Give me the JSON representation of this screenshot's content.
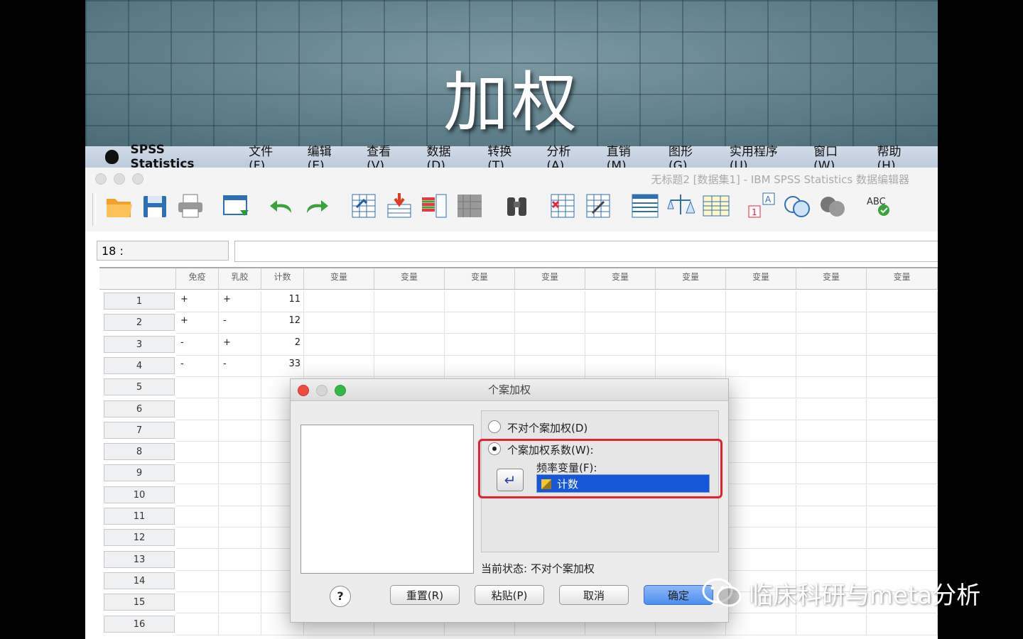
{
  "slide": {
    "title": "加权"
  },
  "menubar": {
    "app": "SPSS Statistics",
    "items": [
      "文件(F)",
      "编辑(E)",
      "查看(V)",
      "数据(D)",
      "转换(T)",
      "分析(A)",
      "直销(M)",
      "图形(G)",
      "实用程序(U)",
      "窗口(W)",
      "帮助(H)"
    ]
  },
  "window": {
    "title": "无标题2 [数据集1] - IBM SPSS Statistics 数据编辑器"
  },
  "toolbar": {
    "icons": [
      "open-folder-icon",
      "save-icon",
      "print-icon",
      "recall-dialog-icon",
      "undo-icon",
      "redo-icon",
      "goto-case-icon",
      "goto-variable-icon",
      "variables-icon",
      "run-descriptive-icon",
      "find-icon",
      "insert-cases-icon",
      "insert-variable-icon",
      "split-file-icon",
      "weight-cases-icon",
      "select-cases-icon",
      "value-labels-icon",
      "use-sets-icon",
      "show-all-variables-icon",
      "spell-check-icon"
    ]
  },
  "cell_editor": {
    "ref": "18 :",
    "value": ""
  },
  "grid": {
    "columns": [
      "免疫",
      "乳胶",
      "计数",
      "变量",
      "变量",
      "变量",
      "变量",
      "变量",
      "变量",
      "变量",
      "变量",
      "变量"
    ],
    "row_numbers": [
      "1",
      "2",
      "3",
      "4",
      "5",
      "6",
      "7",
      "8",
      "9",
      "10",
      "11",
      "12",
      "13",
      "14",
      "15",
      "16"
    ],
    "rows": [
      [
        "+",
        "+",
        "11"
      ],
      [
        "+",
        "-",
        "12"
      ],
      [
        "-",
        "+",
        "2"
      ],
      [
        "-",
        "-",
        "33"
      ]
    ]
  },
  "dialog": {
    "title": "个案加权",
    "radio_none": "不对个案加权(D)",
    "radio_weight": "个案加权系数(W):",
    "freq_label": "频率变量(F):",
    "freq_value": "计数",
    "status": "当前状态:  不对个案加权",
    "buttons": {
      "help": "?",
      "reset": "重置(R)",
      "paste": "粘贴(P)",
      "cancel": "取消",
      "ok": "确定"
    }
  },
  "watermark": {
    "text": "临床科研与meta分析"
  }
}
